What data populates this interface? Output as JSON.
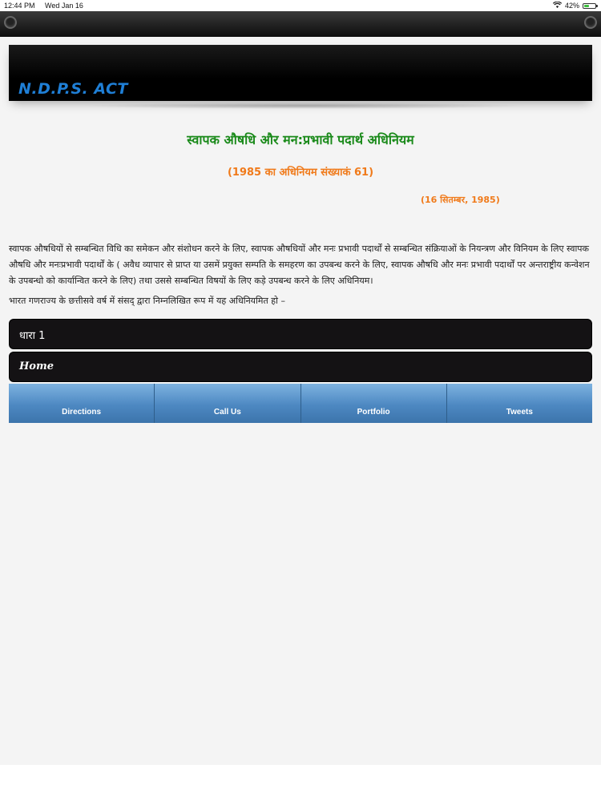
{
  "status_bar": {
    "time": "12:44 PM",
    "date": "Wed Jan 16",
    "battery": "42%",
    "battery_level": 0.42,
    "wifi_icon": "wifi-icon"
  },
  "header": {
    "title": "N.D.P.S. ACT"
  },
  "content": {
    "title": "स्वापक औषधि और मन:प्रभावी पदार्थ अधिनियम",
    "subtitle": "(1985 का अधिनियम संख्याकं 61)",
    "date": "(16 सितम्बर, 1985)",
    "preamble": "स्वापक औषधियों से सम्बन्धित विधि का समेकन और संशोधन करने के लिए, स्वापक औषधियों और मनः प्रभावी पदार्थों से सम्बन्धित संक्रियाओं के नियन्त्रण और विनियम के लिए स्वापक औषधि और मनःप्रभावी पदार्थों के ( अवैध व्यापार से प्राप्त या उसमें प्रयुक्त सम्पति के समहरण का उपबन्ध करने के लिए, स्वापक औषधि और मनः प्रभावी पदार्थों पर अन्तराष्ट्रीय कन्वेशन के उपबन्धो को कार्यान्वित करने के लिए) तथा उससे सम्बन्धित विषयों के लिए कड़े उपबन्ध करने के लिए अधिनियम।",
    "enactment": "भारत गणराज्य के छत्तीसवे  वर्ष में संसद् द्वारा निम्नलिखित रूप में यह अधिनियमित हो –"
  },
  "nav": {
    "section_label": "धारा 1",
    "home_label": "Home"
  },
  "tabs": [
    {
      "label": "Directions"
    },
    {
      "label": "Call Us"
    },
    {
      "label": "Portfolio"
    },
    {
      "label": "Tweets"
    }
  ]
}
